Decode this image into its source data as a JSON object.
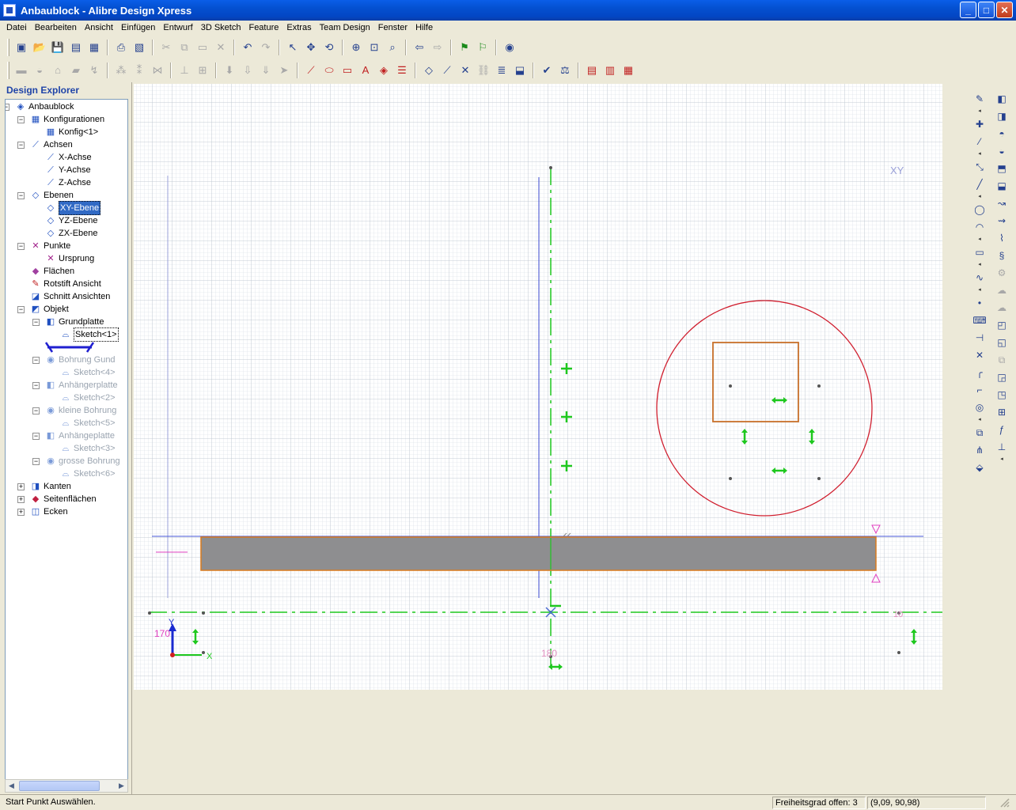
{
  "window": {
    "title": "Anbaublock - Alibre Design Xpress",
    "min": "_",
    "max": "□",
    "close": "✕"
  },
  "menu": [
    "Datei",
    "Bearbeiten",
    "Ansicht",
    "Einfügen",
    "Entwurf",
    "3D Sketch",
    "Feature",
    "Extras",
    "Team Design",
    "Fenster",
    "Hilfe"
  ],
  "explorer": {
    "header": "Design Explorer",
    "items": [
      {
        "label": "Anbaublock",
        "level": 0,
        "toggle": "−",
        "icon": "part-icon"
      },
      {
        "label": "Konfigurationen",
        "level": 1,
        "toggle": "−",
        "icon": "table-icon"
      },
      {
        "label": "Konfig<1>",
        "level": 2,
        "toggle": "",
        "icon": "table-icon"
      },
      {
        "label": "Achsen",
        "level": 1,
        "toggle": "−",
        "icon": "axis-icon"
      },
      {
        "label": "X-Achse",
        "level": 2,
        "toggle": "",
        "icon": "axis-icon"
      },
      {
        "label": "Y-Achse",
        "level": 2,
        "toggle": "",
        "icon": "axis-icon"
      },
      {
        "label": "Z-Achse",
        "level": 2,
        "toggle": "",
        "icon": "axis-icon"
      },
      {
        "label": "Ebenen",
        "level": 1,
        "toggle": "−",
        "icon": "plane-icon"
      },
      {
        "label": "XY-Ebene",
        "level": 2,
        "toggle": "",
        "icon": "plane-icon",
        "state": "selected"
      },
      {
        "label": "YZ-Ebene",
        "level": 2,
        "toggle": "",
        "icon": "plane-icon"
      },
      {
        "label": "ZX-Ebene",
        "level": 2,
        "toggle": "",
        "icon": "plane-icon"
      },
      {
        "label": "Punkte",
        "level": 1,
        "toggle": "−",
        "icon": "point-icon"
      },
      {
        "label": "Ursprung",
        "level": 2,
        "toggle": "",
        "icon": "point-icon"
      },
      {
        "label": "Flächen",
        "level": 1,
        "toggle": "",
        "icon": "surface-icon"
      },
      {
        "label": "Rotstift Ansicht",
        "level": 1,
        "toggle": "",
        "icon": "redline-icon"
      },
      {
        "label": "Schnitt Ansichten",
        "level": 1,
        "toggle": "",
        "icon": "section-icon"
      },
      {
        "label": "Objekt",
        "level": 1,
        "toggle": "−",
        "icon": "body-icon"
      },
      {
        "label": "Grundplatte",
        "level": 2,
        "toggle": "−",
        "icon": "extrude-icon"
      },
      {
        "label": "Sketch<1>",
        "level": 3,
        "toggle": "",
        "icon": "sketch-icon",
        "state": "focus"
      },
      {
        "label": "",
        "level": 2,
        "toggle": "",
        "icon": "rollback-bar-icon"
      },
      {
        "label": "Bohrung Gund",
        "level": 2,
        "toggle": "−",
        "icon": "cut-icon",
        "state": "gray"
      },
      {
        "label": "Sketch<4>",
        "level": 3,
        "toggle": "",
        "icon": "sketch-icon",
        "state": "gray"
      },
      {
        "label": "Anhängerplatte",
        "level": 2,
        "toggle": "−",
        "icon": "extrude-icon",
        "state": "gray"
      },
      {
        "label": "Sketch<2>",
        "level": 3,
        "toggle": "",
        "icon": "sketch-icon",
        "state": "gray"
      },
      {
        "label": "kleine Bohrung",
        "level": 2,
        "toggle": "−",
        "icon": "cut-icon",
        "state": "gray"
      },
      {
        "label": "Sketch<5>",
        "level": 3,
        "toggle": "",
        "icon": "sketch-icon",
        "state": "gray"
      },
      {
        "label": "Anhängeplatte",
        "level": 2,
        "toggle": "−",
        "icon": "extrude-icon",
        "state": "gray"
      },
      {
        "label": "Sketch<3>",
        "level": 3,
        "toggle": "",
        "icon": "sketch-icon",
        "state": "gray"
      },
      {
        "label": "grosse Bohrung",
        "level": 2,
        "toggle": "−",
        "icon": "cut-icon",
        "state": "gray"
      },
      {
        "label": "Sketch<6>",
        "level": 3,
        "toggle": "",
        "icon": "sketch-icon",
        "state": "gray"
      },
      {
        "label": "Kanten",
        "level": 1,
        "toggle": "+",
        "icon": "edge-icon"
      },
      {
        "label": "Seitenflächen",
        "level": 1,
        "toggle": "+",
        "icon": "face-icon"
      },
      {
        "label": "Ecken",
        "level": 1,
        "toggle": "+",
        "icon": "vertex-icon"
      }
    ]
  },
  "canvas": {
    "plane_label": "XY",
    "dim_y": "170",
    "dim_x": "180",
    "dim_right": "10",
    "axis_y": "Y",
    "axis_x": "X",
    "colors": {
      "grid": "#c8d0dc",
      "green": "#1ec81e",
      "red": "#d01e2e",
      "orange": "#d87a1e",
      "block": "#8e8e90",
      "blue": "#2a2ac8",
      "magenta": "#e040c0"
    }
  },
  "status": {
    "message": "Start Punkt Auswählen.",
    "dof": "Freiheitsgrad offen: 3",
    "coords": "(9,09, 90,98)"
  }
}
